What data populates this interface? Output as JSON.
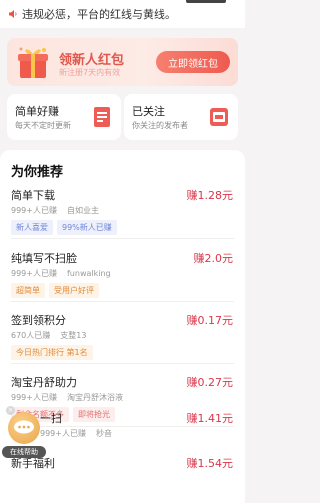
{
  "notice": {
    "text": "违规必惩，平台的红线与黄线。"
  },
  "banner": {
    "title": "领新人红包",
    "subtitle": "新注册7天内有效",
    "button": "立即领红包"
  },
  "cards": [
    {
      "title": "简单好赚",
      "subtitle": "每天不定时更新",
      "icon": "document-icon"
    },
    {
      "title": "已关注",
      "subtitle": "你关注的发布者",
      "icon": "follow-icon"
    }
  ],
  "section_title": "为你推荐",
  "tasks": [
    {
      "name": "简单下载",
      "meta": [
        "999+人已赚",
        "自如业主"
      ],
      "reward": "赚1.28元",
      "tags": [
        {
          "text": "新人喜爱",
          "style": "blue"
        },
        {
          "text": "99%新人已赚",
          "style": "blue"
        }
      ]
    },
    {
      "name": "纯填写不扫脸",
      "meta": [
        "999+人已赚",
        "funwalking"
      ],
      "reward": "赚2.0元",
      "tags": [
        {
          "text": "超简单",
          "style": "orange"
        },
        {
          "text": "受用户好评",
          "style": "orange"
        }
      ]
    },
    {
      "name": "签到领积分",
      "meta": [
        "670人已赚",
        "支整13"
      ],
      "reward": "赚0.17元",
      "tags": [
        {
          "text": "今日热门排行 第1名",
          "style": "orange"
        }
      ]
    },
    {
      "name": "淘宝丹舒助力",
      "meta": [
        "999+人已赚",
        "淘宝丹舒沐浴液"
      ],
      "reward": "赚0.27元",
      "tags": [
        {
          "text": "剩余名额不多",
          "style": "pink"
        },
        {
          "text": "即将抢光",
          "style": "pink"
        }
      ]
    },
    {
      "name": "一扫",
      "meta": [
        "999+人已赚",
        "秒音"
      ],
      "reward": "赚1.41元",
      "tags": []
    },
    {
      "name": "新手福利",
      "meta": [],
      "reward": "赚1.54元",
      "tags": []
    }
  ],
  "helper": {
    "label": "在线帮助"
  }
}
